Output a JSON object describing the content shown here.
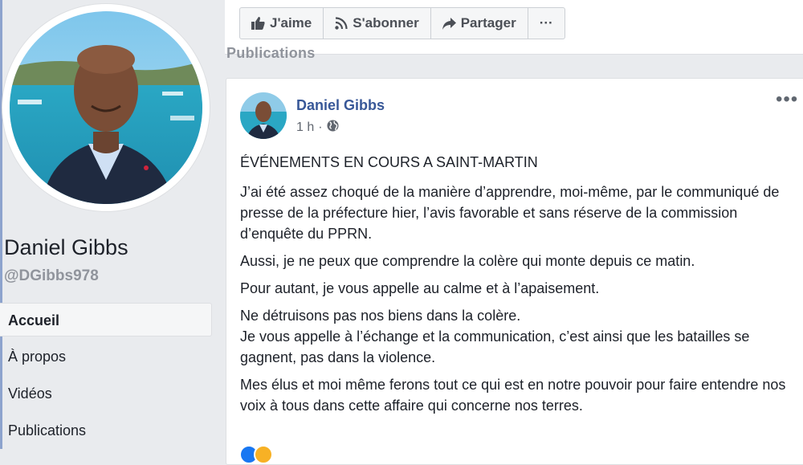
{
  "profile": {
    "name": "Daniel Gibbs",
    "handle": "@DGibbs978"
  },
  "nav": {
    "items": [
      {
        "label": "Accueil",
        "active": true
      },
      {
        "label": "À propos"
      },
      {
        "label": "Vidéos"
      },
      {
        "label": "Publications"
      }
    ]
  },
  "actions": {
    "like": "J'aime",
    "subscribe": "S'abonner",
    "share": "Partager",
    "more": "···"
  },
  "section": {
    "title": "Publications"
  },
  "post": {
    "author": "Daniel Gibbs",
    "time": "1 h",
    "separator": "·",
    "audience_icon": "globe-icon",
    "options": "•••",
    "title": "ÉVÉNEMENTS EN COURS A SAINT-MARTIN",
    "paragraphs": [
      "J’ai été assez choqué de la manière d’apprendre, moi-même, par le communiqué de presse de la préfecture hier, l’avis favorable et sans réserve de la commission d’enquête du PPRN.",
      "Aussi, je ne peux que comprendre la colère qui monte depuis ce matin.",
      "Pour autant, je vous appelle au calme et à l’apaisement.",
      "Ne détruisons pas nos biens dans la colère.\nJe vous appelle à l’échange et la communication, c’est ainsi que les batailles se gagnent, pas dans la violence.",
      "Mes élus et moi même ferons tout ce qui est en notre pouvoir pour faire entendre nos voix à tous dans cette affaire qui concerne nos terres."
    ]
  },
  "colors": {
    "link": "#385898",
    "background": "#e9ebee",
    "muted": "#90949c"
  }
}
